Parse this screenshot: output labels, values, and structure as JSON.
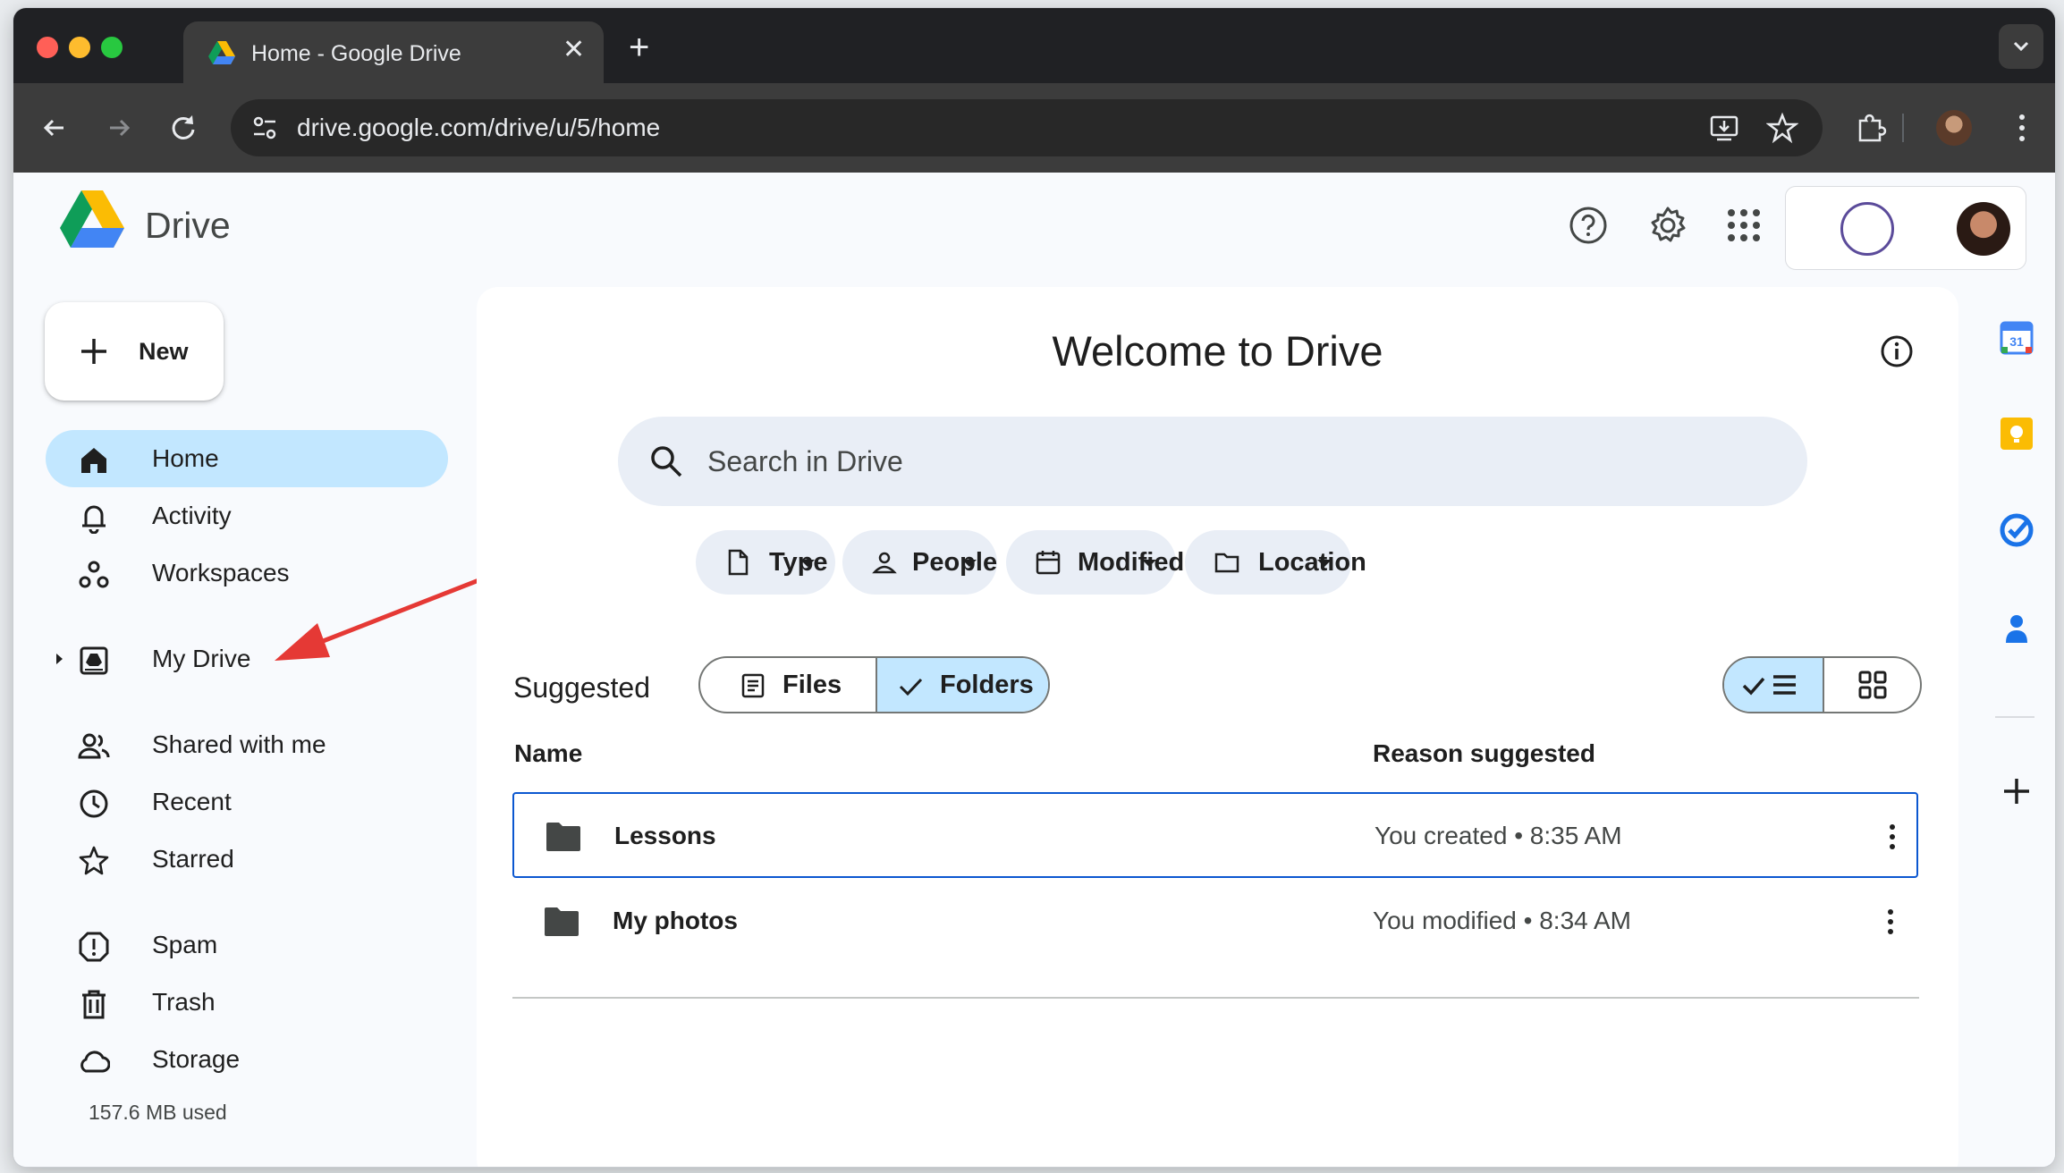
{
  "browser": {
    "tab": {
      "title": "Home - Google Drive"
    },
    "url": "drive.google.com/drive/u/5/home"
  },
  "app": {
    "name": "Drive",
    "new_button": "New",
    "nav": [
      {
        "label": "Home",
        "icon": "home-icon",
        "active": true
      },
      {
        "label": "Activity",
        "icon": "bell-icon"
      },
      {
        "label": "Workspaces",
        "icon": "workspaces-icon"
      },
      {
        "label": "My Drive",
        "icon": "my-drive-icon"
      },
      {
        "label": "Shared with me",
        "icon": "people-icon"
      },
      {
        "label": "Recent",
        "icon": "clock-icon"
      },
      {
        "label": "Starred",
        "icon": "star-icon"
      },
      {
        "label": "Spam",
        "icon": "spam-icon"
      },
      {
        "label": "Trash",
        "icon": "trash-icon"
      },
      {
        "label": "Storage",
        "icon": "cloud-icon"
      }
    ],
    "storage_used": "157.6 MB used"
  },
  "main": {
    "title": "Welcome to Drive",
    "search_placeholder": "Search in Drive",
    "filters": [
      "Type",
      "People",
      "Modified",
      "Location"
    ],
    "suggested_label": "Suggested",
    "segment": {
      "files": "Files",
      "folders": "Folders",
      "selected": "Folders"
    },
    "columns": {
      "name": "Name",
      "reason": "Reason suggested"
    },
    "rows": [
      {
        "name": "Lessons",
        "reason": "You created • 8:35 AM",
        "selected": true
      },
      {
        "name": "My photos",
        "reason": "You modified • 8:34 AM",
        "selected": false
      }
    ]
  },
  "colors": {
    "active_nav": "#c2e7ff",
    "search_bg": "#e9eef6",
    "annotation_arrow": "#e53935",
    "selection_border": "#0b57d0"
  }
}
